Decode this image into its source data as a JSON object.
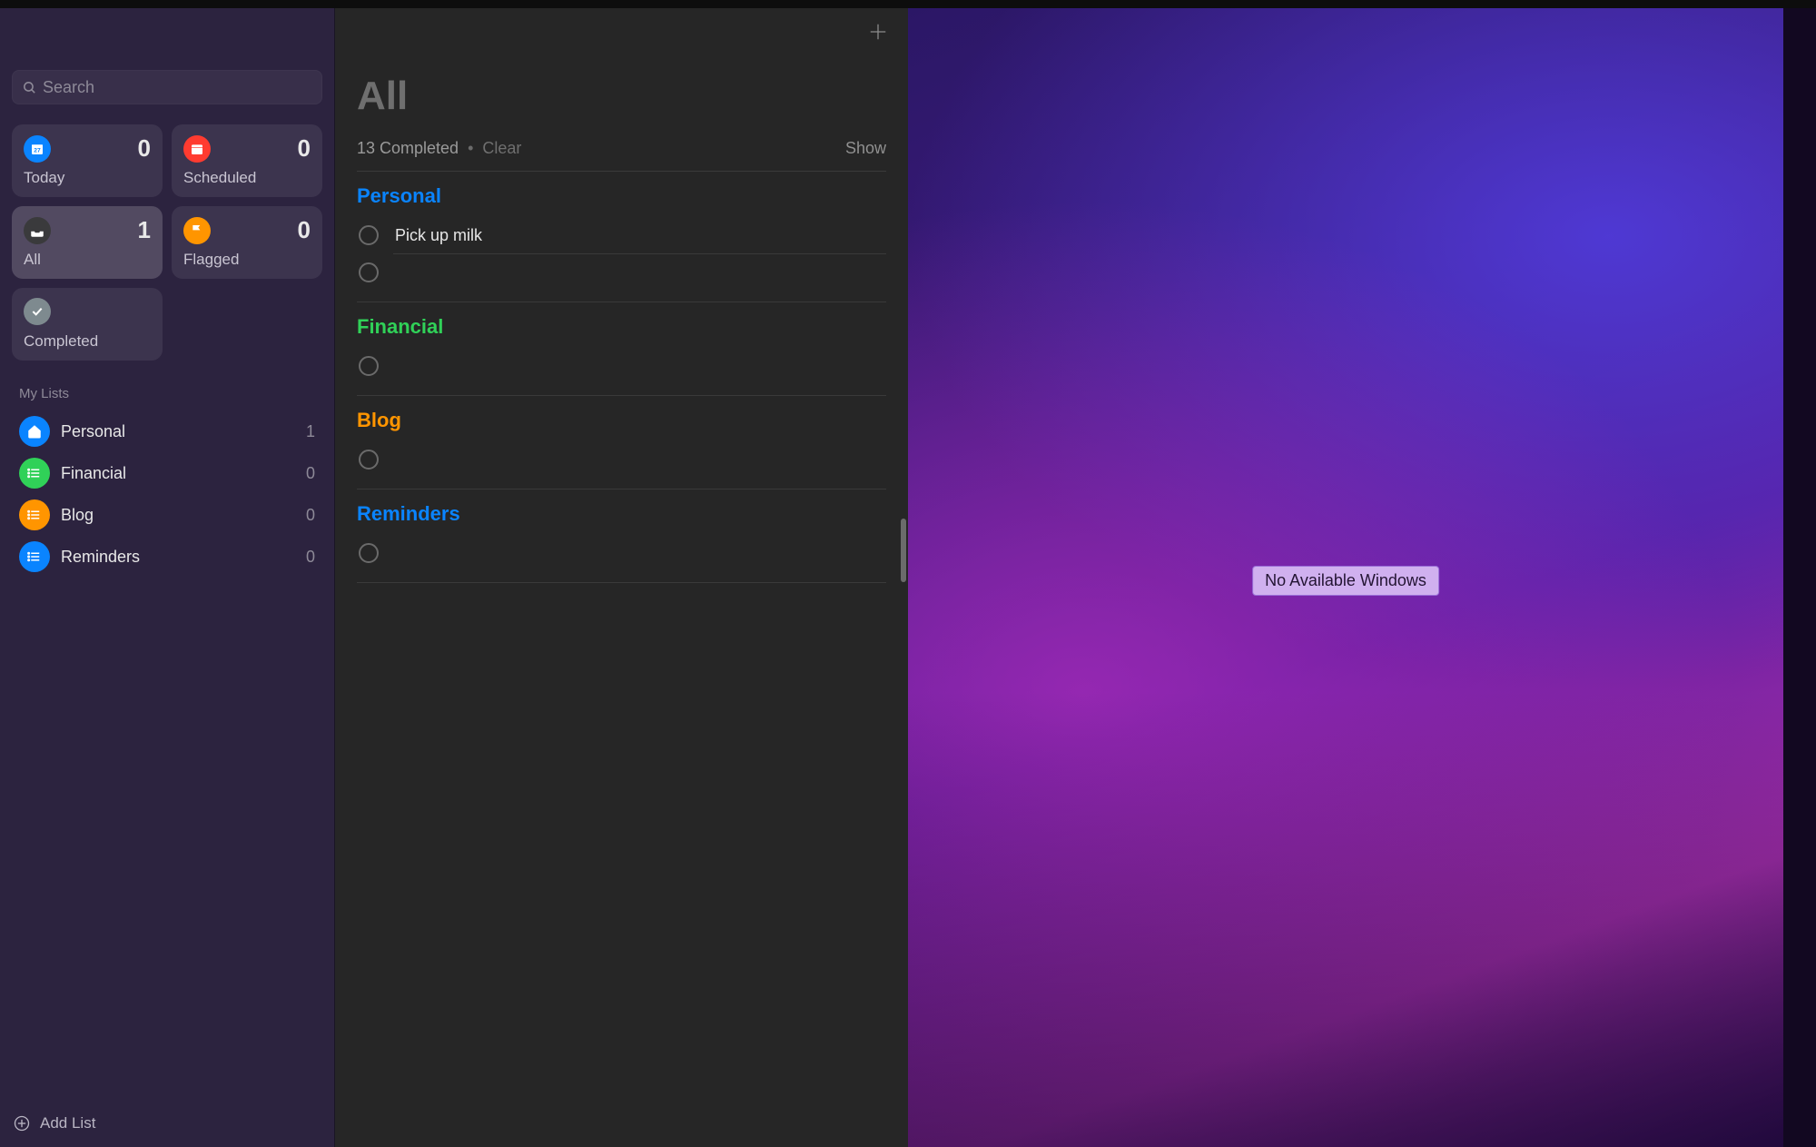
{
  "search": {
    "placeholder": "Search"
  },
  "smart": {
    "today": {
      "label": "Today",
      "count": 0
    },
    "scheduled": {
      "label": "Scheduled",
      "count": 0
    },
    "all": {
      "label": "All",
      "count": 1
    },
    "flagged": {
      "label": "Flagged",
      "count": 0
    },
    "completed": {
      "label": "Completed"
    }
  },
  "mylists": {
    "header": "My Lists",
    "items": [
      {
        "name": "Personal",
        "count": 1,
        "color": "#0a84ff"
      },
      {
        "name": "Financial",
        "count": 0,
        "color": "#30d158"
      },
      {
        "name": "Blog",
        "count": 0,
        "color": "#ff9500"
      },
      {
        "name": "Reminders",
        "count": 0,
        "color": "#0a84ff"
      }
    ]
  },
  "footer": {
    "add_list": "Add List"
  },
  "content": {
    "title": "All",
    "completed_text": "13 Completed",
    "clear": "Clear",
    "show": "Show",
    "groups": [
      {
        "title": "Personal",
        "color": "#0a84ff",
        "tasks": [
          "Pick up milk"
        ],
        "has_empty_row": true
      },
      {
        "title": "Financial",
        "color": "#30d158",
        "tasks": [],
        "has_empty_row": true
      },
      {
        "title": "Blog",
        "color": "#ff9500",
        "tasks": [],
        "has_empty_row": true
      },
      {
        "title": "Reminders",
        "color": "#0a84ff",
        "tasks": [],
        "has_empty_row": true
      }
    ]
  },
  "desktop": {
    "tooltip": "No Available Windows"
  }
}
